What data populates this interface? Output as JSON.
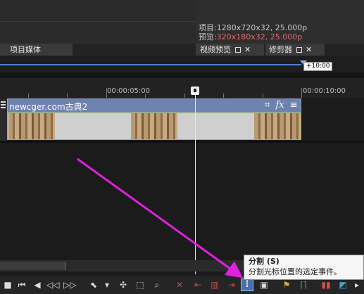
{
  "project_info": {
    "project_label": "项目:",
    "project_value": "1280x720x32, 25.000p",
    "preview_label": "预览:",
    "preview_value": "320x180x32, 25.000p",
    "preview_color": "#e06a6a"
  },
  "tabs": {
    "media": "项目媒体",
    "video_preview": "视频预览",
    "trimmer": "修剪器"
  },
  "ruler": {
    "marker_label": "+10:00",
    "t1": "00:00:05:00",
    "t2": "00:00:10:00"
  },
  "clip": {
    "title": "newcger.com古典2",
    "accent": "#6e82b0",
    "icons": [
      "crop-icon",
      "fx-icon",
      "menu-icon"
    ]
  },
  "tooltip": {
    "title": "分割 (S)",
    "description": "分割光标位置的选定事件。"
  },
  "toolbar": {
    "buttons": [
      "stop-icon",
      "go-start-icon",
      "prev-frame-icon",
      "play-prev-icon",
      "play-next-icon",
      "next-frame-icon",
      "normal-edit-tool-icon",
      "dropdown-icon",
      "envelope-tool-icon",
      "selection-tool-icon",
      "zoom-tool-icon",
      "delete-icon",
      "trim-start-icon",
      "trim-icon",
      "trim-end-icon",
      "split-icon",
      "lock-icon",
      "marker-icon",
      "region-icon",
      "insert-icon",
      "snap-icon"
    ]
  }
}
